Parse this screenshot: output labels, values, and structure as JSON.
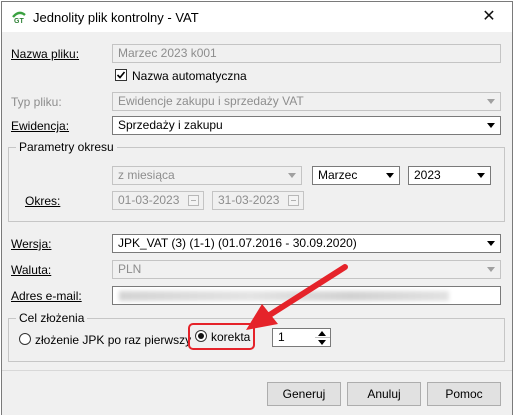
{
  "window": {
    "title": "Jednolity plik kontrolny - VAT",
    "close_glyph": "✕"
  },
  "nazwa_pliku": {
    "label": "Nazwa pliku:",
    "value": "Marzec 2023 k001"
  },
  "nazwa_automatyczna": {
    "label": "Nazwa automatyczna",
    "checked": true
  },
  "typ_pliku": {
    "label": "Typ pliku:",
    "value": "Ewidencje zakupu i sprzedaży VAT"
  },
  "ewidencja": {
    "label": "Ewidencja:",
    "value": "Sprzedaży i zakupu"
  },
  "parametry": {
    "legend": "Parametry okresu",
    "okres_typ": "z miesiąca",
    "miesiac": "Marzec",
    "rok": "2023",
    "okres_label": "Okres:",
    "od": "01-03-2023",
    "do": "31-03-2023"
  },
  "wersja": {
    "label": "Wersja:",
    "value": "JPK_VAT (3) (1-1) (01.07.2016 - 30.09.2020)"
  },
  "waluta": {
    "label": "Waluta:",
    "value": "PLN"
  },
  "email": {
    "label": "Adres e-mail:",
    "value": ""
  },
  "cel": {
    "legend": "Cel złożenia",
    "option1": "złożenie JPK po raz pierwszy",
    "option2": "korekta",
    "selected": "korekta",
    "korekta_number": "1"
  },
  "buttons": {
    "generuj": "Generuj",
    "anuluj": "Anuluj",
    "pomoc": "Pomoc"
  },
  "colors": {
    "highlight": "#e5232a",
    "dialog_bg": "#f0f0f0"
  }
}
